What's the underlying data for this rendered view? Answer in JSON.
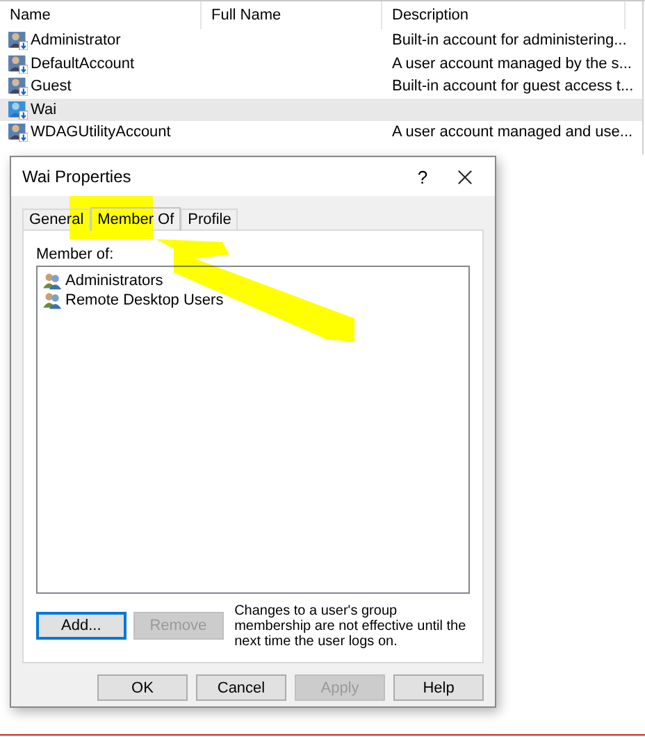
{
  "list": {
    "columns": [
      "Name",
      "Full Name",
      "Description"
    ],
    "rows": [
      {
        "name": "Administrator",
        "description": "Built-in account for administering...",
        "selected": false
      },
      {
        "name": "DefaultAccount",
        "description": "A user account managed by the s...",
        "selected": false
      },
      {
        "name": "Guest",
        "description": "Built-in account for guest access t...",
        "selected": false
      },
      {
        "name": "Wai",
        "selected": true
      },
      {
        "name": "WDAGUtilityAccount",
        "description": "A user account managed and use...",
        "selected": false
      }
    ]
  },
  "dialog": {
    "title": "Wai Properties",
    "help": "?",
    "tabs": [
      {
        "label": "General",
        "selected": false
      },
      {
        "label": "Member Of",
        "selected": true
      },
      {
        "label": "Profile",
        "selected": false
      }
    ],
    "member_label": "Member of:",
    "groups": [
      "Administrators",
      "Remote Desktop Users"
    ],
    "group_buttons": [
      {
        "label": "Add...",
        "disabled": false,
        "focused": true
      },
      {
        "label": "Remove",
        "disabled": true,
        "focused": false
      }
    ],
    "note": "Changes to a user's group membership are not effective until the next time the user logs on.",
    "buttons": [
      {
        "label": "OK",
        "disabled": false,
        "focused": false
      },
      {
        "label": "Cancel",
        "disabled": false,
        "focused": false
      },
      {
        "label": "Apply",
        "disabled": true,
        "focused": false
      },
      {
        "label": "Help",
        "disabled": false,
        "focused": false
      }
    ]
  }
}
